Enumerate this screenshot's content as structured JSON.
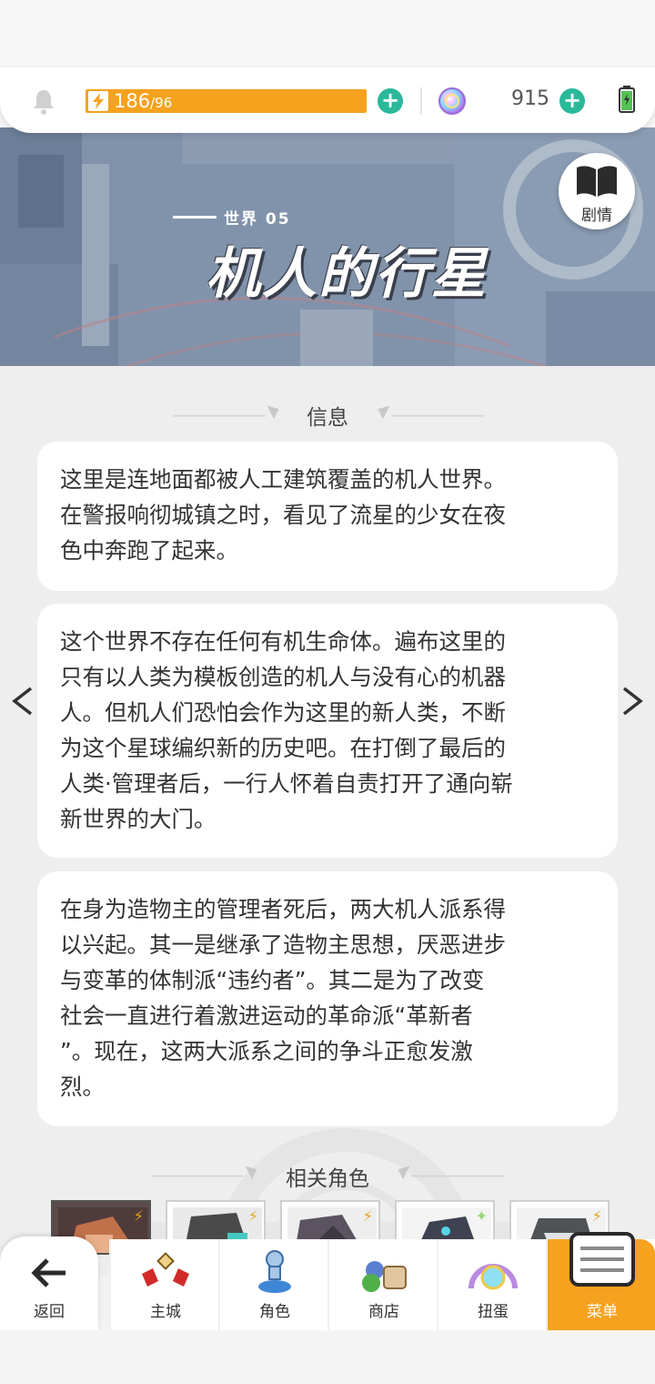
{
  "header": {
    "energy_current": "186",
    "energy_max": "/96",
    "gem_count": "915"
  },
  "banner": {
    "world_label": "世界 05",
    "world_title": "机人的行星",
    "story_button_label": "剧情"
  },
  "info": {
    "section_title": "信息",
    "paragraphs": [
      "这里是连地面都被人工建筑覆盖的机人世界。在警报响彻城镇之时，看见了流星的少女在夜色中奔跑了起来。",
      "这个世界不存在任何有机生命体。遍布这里的只有以人类为模板创造的机人与没有心的机器人。但机人们恐怕会作为这里的新人类，不断为这个星球编织新的历史吧。在打倒了最后的人类·管理者后，一行人怀着自责打开了通向崭新世界的大门。",
      "在身为造物主的管理者死后，两大机人派系得以兴起。其一是继承了造物主思想，厌恶进步与变革的体制派“违约者”。其二是为了改变社会一直进行着激进运动的革命派“革新者”。现在，这两大派系之间的争斗正愈发激烈。"
    ],
    "card1_lines": [
      "这里是连地面都被人工建筑覆盖的机人世界。",
      "在警报响彻城镇之时，看见了流星的少女在夜",
      "色中奔跑了起来。"
    ],
    "card2_lines": [
      "这个世界不存在任何有机生命体。遍布这里的",
      "只有以人类为模板创造的机人与没有心的机器",
      "人。但机人们恐怕会作为这里的新人类，不断",
      "为这个星球编织新的历史吧。在打倒了最后的",
      "人类·管理者后，一行人怀着自责打开了通向崭",
      "新世界的大门。"
    ],
    "card3_lines": [
      "在身为造物主的管理者死后，两大机人派系得",
      "以兴起。其一是继承了造物主思想，厌恶进步",
      "与变革的体制派“违约者”。其二是为了改变",
      "社会一直进行着激进运动的革命派“革新者",
      "”。现在，这两大派系之间的争斗正愈发激",
      "烈。"
    ]
  },
  "related": {
    "section_title": "相关角色"
  },
  "nav": {
    "back": "返回",
    "items": [
      "主城",
      "角色",
      "商店",
      "扭蛋",
      "菜单"
    ]
  },
  "colors": {
    "accent_orange": "#f5a21f",
    "plus_green": "#2bb99a"
  }
}
